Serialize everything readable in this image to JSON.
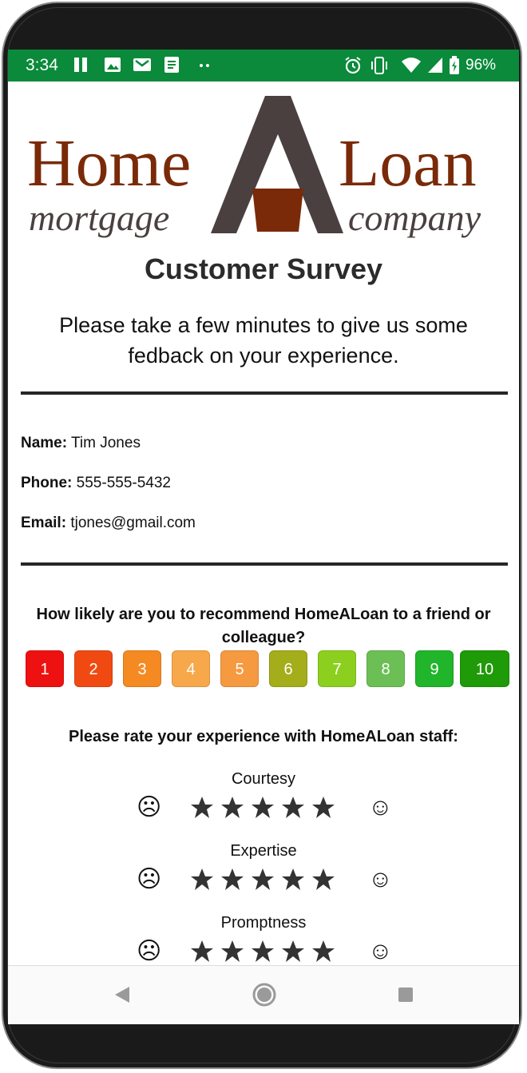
{
  "status_bar": {
    "time": "3:34",
    "battery": "96%",
    "color": "#0a8a3a"
  },
  "logo": {
    "word_left": "Home",
    "word_right": "Loan",
    "sub_left": "mortgage",
    "sub_right": "company",
    "brand_color": "#7a2a08",
    "dark_color": "#4a4040"
  },
  "survey": {
    "title": "Customer Survey",
    "intro": "Please take a few minutes to give us some fedback on your experience."
  },
  "customer": {
    "name_label": "Name:",
    "name": "Tim Jones",
    "phone_label": "Phone:",
    "phone": "555-555-5432",
    "email_label": "Email:",
    "email": "tjones@gmail.com"
  },
  "recommend": {
    "question": "How likely are you to recommend HomeALoan to a friend or colleague?",
    "options": [
      {
        "label": "1",
        "color": "#ee1111"
      },
      {
        "label": "2",
        "color": "#f04a12"
      },
      {
        "label": "3",
        "color": "#f58a22"
      },
      {
        "label": "4",
        "color": "#f7a84a"
      },
      {
        "label": "5",
        "color": "#f59a40"
      },
      {
        "label": "6",
        "color": "#a4ad1a"
      },
      {
        "label": "7",
        "color": "#8ccf1e"
      },
      {
        "label": "8",
        "color": "#6bbf55"
      },
      {
        "label": "9",
        "color": "#20b52a"
      },
      {
        "label": "10",
        "color": "#1f9a08"
      }
    ]
  },
  "staff_rating": {
    "question": "Please rate your experience with HomeALoan staff:",
    "categories": [
      {
        "label": "Courtesy",
        "stars": 5
      },
      {
        "label": "Expertise",
        "stars": 5
      },
      {
        "label": "Promptness",
        "stars": 5
      }
    ],
    "low_icon": "sad-face-icon",
    "high_icon": "happy-face-icon"
  },
  "nav": {
    "back_icon": "back-triangle-icon",
    "home_icon": "home-circle-icon",
    "recents_icon": "recents-square-icon"
  }
}
